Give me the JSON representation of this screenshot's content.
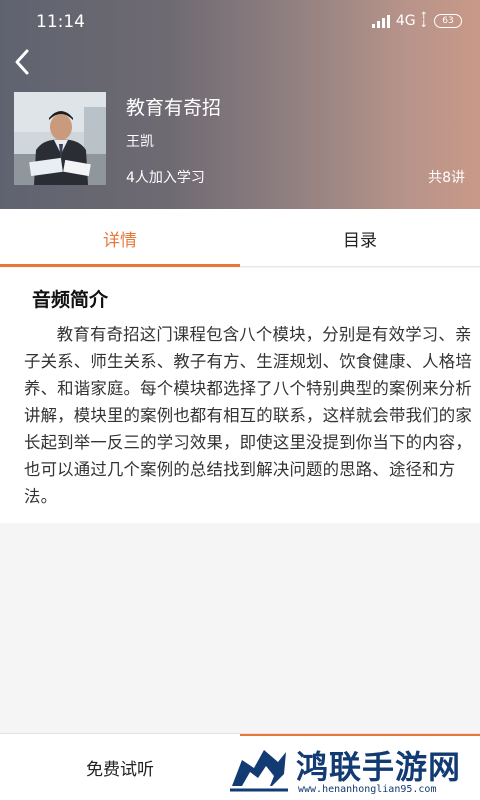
{
  "status_bar": {
    "time": "11:14",
    "network": "4G",
    "battery": "63"
  },
  "course": {
    "title": "教育有奇招",
    "teacher": "王凯",
    "learners": "4人加入学习",
    "lessons": "共8讲"
  },
  "tabs": [
    {
      "label": "详情",
      "active": true
    },
    {
      "label": "目录",
      "active": false
    }
  ],
  "intro": {
    "heading": "音频简介",
    "body": "教育有奇招这门课程包含八个模块，分别是有效学习、亲子关系、师生关系、教子有方、生涯规划、饮食健康、人格培养、和谐家庭。每个模块都选择了八个特别典型的案例来分析讲解，模块里的案例也都有相互的联系，这样就会带我们的家长起到举一反三的学习效果，即使这里没提到你当下的内容，也可以通过几个案例的总结找到解决问题的思路、途径和方法。"
  },
  "bottom": {
    "trial_label": "免费试听"
  },
  "watermark": {
    "name": "鸿联手游网",
    "url": "www.henanhonglian95.com"
  },
  "colors": {
    "accent": "#e8783a",
    "watermark": "#123a73"
  }
}
